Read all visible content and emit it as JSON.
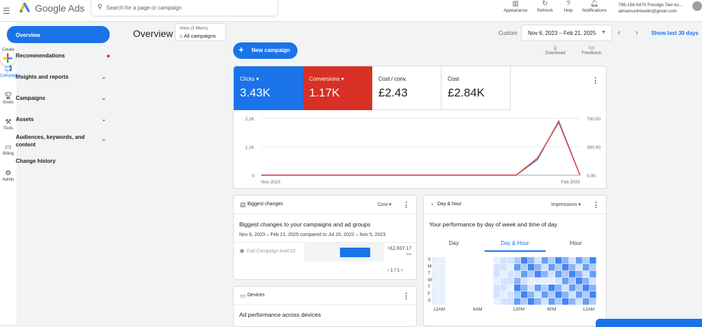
{
  "header": {
    "app_name": "Google Ads",
    "search_placeholder": "Search for a page or campaign",
    "tools": [
      {
        "icon": "appearance-icon",
        "label": "Appearance"
      },
      {
        "icon": "refresh-icon",
        "label": "Refresh"
      },
      {
        "icon": "help-icon",
        "label": "Help"
      },
      {
        "icon": "notifications-icon",
        "label": "Notifications"
      }
    ],
    "account_name": "796-156-5470 Prestige Taxi As...",
    "account_email": "almamunlinkedin@gmail.com"
  },
  "rail": {
    "items": [
      "Create",
      "Campaigns",
      "Goals",
      "Tools",
      "Billing",
      "Admin"
    ]
  },
  "sidebar": {
    "items": [
      {
        "label": "Overview",
        "active": true
      },
      {
        "label": "Recommendations",
        "dot": true
      },
      {
        "label": "Insights and reports",
        "chevron": true
      },
      {
        "label": "Campaigns",
        "chevron": true
      },
      {
        "label": "Assets",
        "chevron": true
      },
      {
        "label": "Audiences, keywords, and content",
        "chevron": true
      },
      {
        "label": "Change history"
      }
    ]
  },
  "page": {
    "title": "Overview",
    "view_filters": "View (2 filters)",
    "view_value": "All campaigns",
    "date_mode": "Custom",
    "date_range": "Nov 6, 2023 – Feb 21, 2025",
    "show_last": "Show last 30 days",
    "new_campaign": "New campaign",
    "download": "Download",
    "feedback": "Feedback"
  },
  "metrics": [
    {
      "name": "Clicks",
      "value": "3.43K",
      "color": "#1a73e8",
      "dropdown": true
    },
    {
      "name": "Conversions",
      "value": "1.17K",
      "color": "#d93025",
      "dropdown": true
    },
    {
      "name": "Cost / conv.",
      "value": "£2.43"
    },
    {
      "name": "Cost",
      "value": "£2.84K"
    }
  ],
  "chart_data": {
    "type": "line",
    "x": [
      "Nov 2023",
      "",
      "",
      "",
      "",
      "",
      "",
      "",
      "",
      "",
      "",
      "",
      "",
      "",
      "",
      "Feb 2025"
    ],
    "xticks": [
      "Nov 2023",
      "Feb 2025"
    ],
    "left_axis": {
      "ticks": [
        "0",
        "1.1K",
        "2.2K"
      ],
      "ylim": [
        0,
        2200
      ]
    },
    "right_axis": {
      "ticks": [
        "0.00",
        "350.00",
        "700.00"
      ],
      "ylim": [
        0,
        700
      ]
    },
    "series": [
      {
        "name": "Clicks",
        "color": "#4285f4",
        "axis": "left",
        "values": [
          0,
          0,
          0,
          0,
          0,
          0,
          0,
          0,
          0,
          0,
          0,
          0,
          0,
          600,
          2100,
          0
        ]
      },
      {
        "name": "Conversions",
        "color": "#ea4335",
        "axis": "right",
        "values": [
          0,
          0,
          0,
          0,
          0,
          0,
          0,
          0,
          0,
          0,
          0,
          0,
          0,
          210,
          650,
          0
        ]
      }
    ]
  },
  "biggest_changes": {
    "title": "Biggest changes",
    "metric": "Cost",
    "heading": "Biggest changes to your campaigns and ad groups",
    "compare": "Nov 6, 2023 – Feb 21, 2025 compared to Jul 20, 2022 – Nov 5, 2023",
    "row_name": "Call Campaign Ariel 02",
    "row_value": "+£2,837.17",
    "row_sub": "+∞",
    "pager": "1 / 1"
  },
  "day_hour": {
    "title": "Day & hour",
    "metric": "Impressions",
    "heading": "Your performance by day of week and time of day",
    "tabs": [
      "Day",
      "Day & Hour",
      "Hour"
    ],
    "days": [
      "S",
      "M",
      "T",
      "W",
      "T",
      "F",
      "S"
    ],
    "hours": [
      "12AM",
      "6AM",
      "12PM",
      "6PM",
      "12AM"
    ]
  },
  "devices": {
    "title": "Devices",
    "heading": "Ad performance across devices"
  }
}
